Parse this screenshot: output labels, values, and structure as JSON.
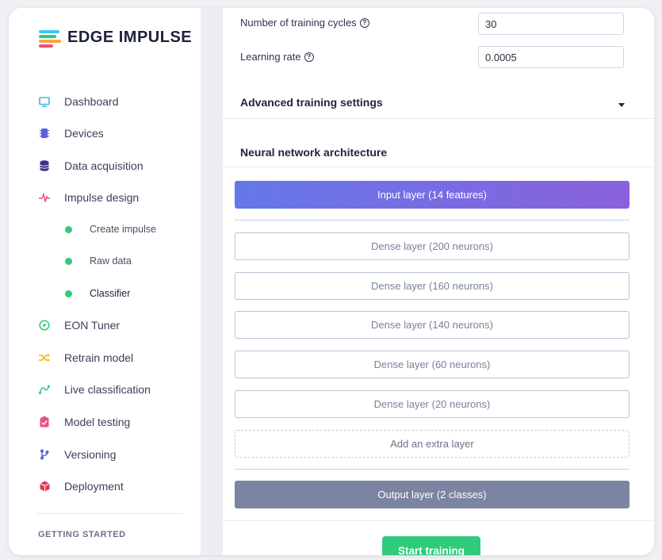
{
  "brand": {
    "name": "EDGE IMPULSE",
    "logo_colors": [
      "#3ec7f4",
      "#2dcc7a",
      "#f7a440",
      "#e6537d"
    ]
  },
  "sidebar": {
    "items": [
      {
        "label": "Dashboard",
        "icon": "monitor-icon",
        "color": "#3ab7e6"
      },
      {
        "label": "Devices",
        "icon": "chip-icon",
        "color": "#5a5fe0"
      },
      {
        "label": "Data acquisition",
        "icon": "database-icon",
        "color": "#3b2f8f"
      },
      {
        "label": "Impulse design",
        "icon": "pulse-icon",
        "color": "#e6537d"
      },
      {
        "label": "Create impulse",
        "sub": true
      },
      {
        "label": "Raw data",
        "sub": true
      },
      {
        "label": "Classifier",
        "sub": true,
        "active": true
      },
      {
        "label": "EON Tuner",
        "icon": "compass-icon",
        "color": "#2dcc7a"
      },
      {
        "label": "Retrain model",
        "icon": "shuffle-icon",
        "color": "#f7b500"
      },
      {
        "label": "Live classification",
        "icon": "route-icon",
        "color": "#2dcc7a"
      },
      {
        "label": "Model testing",
        "icon": "clipboard-check-icon",
        "color": "#e6537d"
      },
      {
        "label": "Versioning",
        "icon": "branch-icon",
        "color": "#5a5fe0"
      },
      {
        "label": "Deployment",
        "icon": "cube-icon",
        "color": "#e8384f"
      }
    ],
    "getting_started": "GETTING STARTED"
  },
  "settings": {
    "training_cycles_label": "Number of training cycles",
    "training_cycles_value": "30",
    "learning_rate_label": "Learning rate",
    "learning_rate_value": "0.0005",
    "advanced_label": "Advanced training settings"
  },
  "architecture": {
    "title": "Neural network architecture",
    "input_layer": "Input layer (14 features)",
    "dense_layers": [
      "Dense layer (200 neurons)",
      "Dense layer (160 neurons)",
      "Dense layer (140 neurons)",
      "Dense layer (60 neurons)",
      "Dense layer (20 neurons)"
    ],
    "add_layer": "Add an extra layer",
    "output_layer": "Output layer (2 classes)"
  },
  "actions": {
    "start_training": "Start training"
  }
}
